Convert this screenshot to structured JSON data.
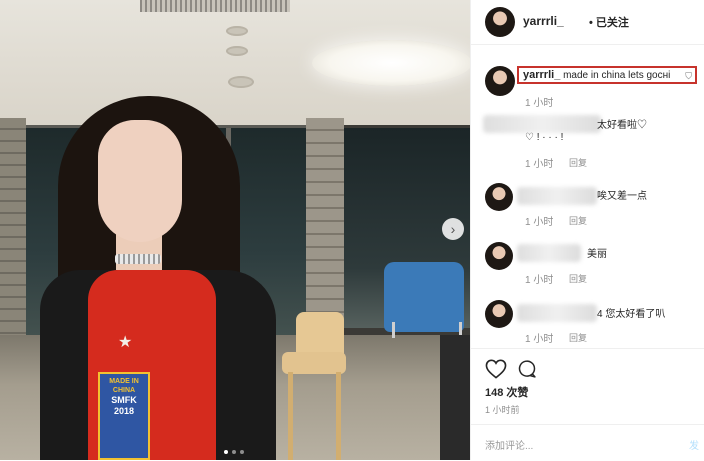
{
  "header": {
    "username": "yarrrli_",
    "follow_label": "• 已关注"
  },
  "caption": {
    "username": "yarrrli_",
    "text": "made in china lets gocнi",
    "time": "1 小时"
  },
  "comments": [
    {
      "text": "太好看啦♡",
      "text2": "♡ ! · · · !",
      "time": "1 小时",
      "reply": "回复"
    },
    {
      "text": "唉又差一点",
      "time": "1 小时",
      "reply": "回复"
    },
    {
      "text": "美丽",
      "time": "1 小时",
      "reply": "回复"
    },
    {
      "text": "4 您太好看了叭",
      "time": "1 小时",
      "reply": "回复"
    }
  ],
  "likes": "148 次赞",
  "posted": "1 小时前",
  "add_comment": {
    "placeholder": "添加评论...",
    "post_label": "发"
  },
  "icons": [
    "heart-icon",
    "comment-icon",
    "next-arrow-icon"
  ],
  "photo": {
    "badge_lines": [
      "MADE IN",
      "CHINA",
      "SMFK",
      "2018"
    ]
  }
}
